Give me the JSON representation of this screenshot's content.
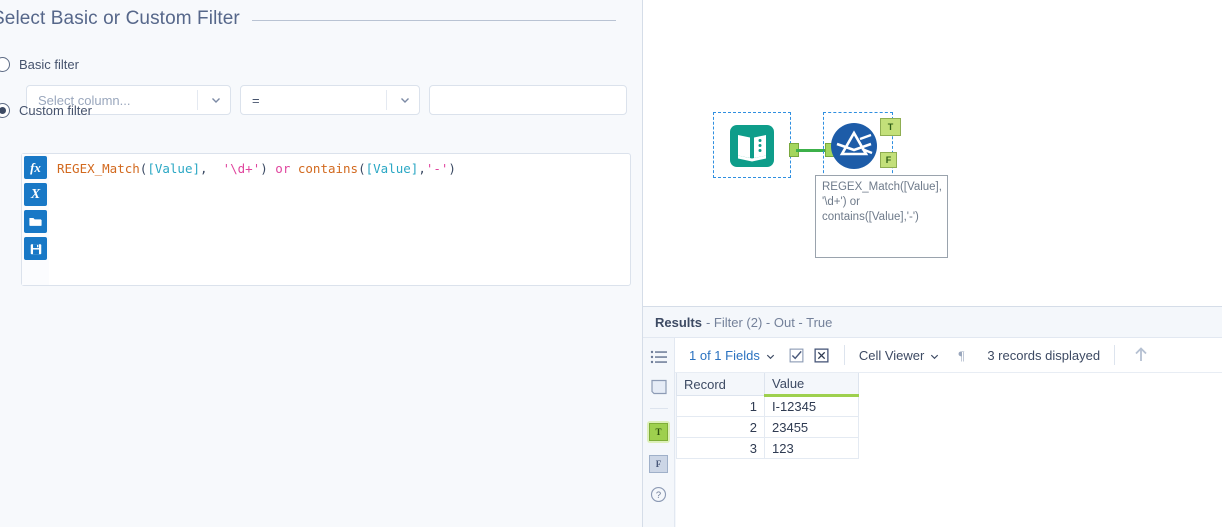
{
  "config": {
    "group_title": "Select Basic or Custom Filter",
    "basic": {
      "radio_label": "Basic filter",
      "selected": false,
      "column_placeholder": "Select column...",
      "column_value": "",
      "operator_value": "=",
      "value_text": "",
      "value_placeholder": ""
    },
    "custom": {
      "radio_label": "Custom filter",
      "selected": true,
      "tools": [
        {
          "name": "insert-function-button",
          "glyph": "fx"
        },
        {
          "name": "insert-variable-button",
          "glyph": "X"
        },
        {
          "name": "open-expression-button",
          "glyph": "folder"
        },
        {
          "name": "save-expression-button",
          "glyph": "save"
        }
      ],
      "expression": "REGEX_Match([Value], '\\d+') or contains([Value],'-')",
      "tokens": [
        {
          "t": "REGEX_Match",
          "c": "fn"
        },
        {
          "t": "(",
          "c": "pl"
        },
        {
          "t": "[Value]",
          "c": "field"
        },
        {
          "t": ", ",
          "c": "pl"
        },
        {
          "t": " '\\d+'",
          "c": "str"
        },
        {
          "t": ")",
          "c": "pl"
        },
        {
          "t": " or ",
          "c": "op"
        },
        {
          "t": "contains",
          "c": "fn"
        },
        {
          "t": "(",
          "c": "pl"
        },
        {
          "t": "[Value]",
          "c": "field"
        },
        {
          "t": ",",
          "c": "pl"
        },
        {
          "t": "'-'",
          "c": "str"
        },
        {
          "t": ")",
          "c": "pl"
        }
      ]
    }
  },
  "canvas": {
    "input_tool_name": "text-input-tool",
    "filter_tool_name": "filter-tool",
    "true_anchor_label": "T",
    "false_anchor_label": "F",
    "annotation_text": "REGEX_Match([Value], '\\d+') or contains([Value],'-')"
  },
  "results": {
    "title": "Results",
    "subtitle": "- Filter (2) - Out - True",
    "toolbar": {
      "fields_label": "1 of 1 Fields",
      "select_all_icon": "checkbox-checked-icon",
      "deselect_all_icon": "checkbox-crossed-icon",
      "viewer_label": "Cell Viewer",
      "pilcrow_icon": "pilcrow-icon",
      "records_label": "3 records displayed",
      "up_arrow_icon": "arrow-up-icon"
    },
    "sidebar": [
      {
        "name": "metadata-list-icon",
        "label": ""
      },
      {
        "name": "data-profile-icon",
        "label": ""
      },
      {
        "name": "output-anchor-true",
        "label": "T",
        "selected": true
      },
      {
        "name": "output-anchor-false",
        "label": "F",
        "selected": false
      },
      {
        "name": "help-icon",
        "label": "?"
      }
    ],
    "grid": {
      "columns": [
        "Record",
        "Value"
      ],
      "rows": [
        {
          "record": "1",
          "value": "I-12345"
        },
        {
          "record": "2",
          "value": "23455"
        },
        {
          "record": "3",
          "value": "123"
        }
      ]
    }
  },
  "colors": {
    "accent_blue": "#2a72c0",
    "anchor_green": "#9ed04e",
    "tool_teal": "#0e9d8a",
    "tool_blue": "#1d5ca8"
  }
}
